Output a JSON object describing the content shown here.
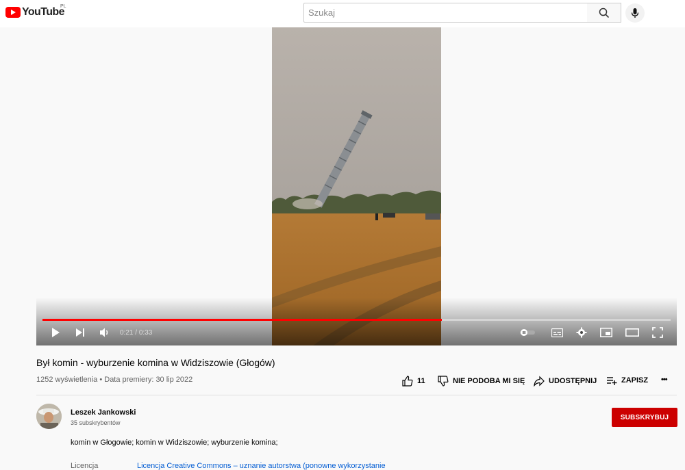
{
  "header": {
    "logo_text": "YouTube",
    "country_code": "PL",
    "search_placeholder": "Szukaj"
  },
  "player": {
    "time_current": "0:21",
    "time_separator": " / ",
    "time_total": "0:33",
    "progress_fraction": 0.636,
    "accent_color": "#ff0000"
  },
  "video": {
    "title": "Był komin - wyburzenie komina w Widziszowie (Głogów)",
    "views": "1252 wyświetlenia",
    "separator": " • ",
    "premiere": "Data premiery: 30 lip 2022"
  },
  "actions": {
    "like_count": "11",
    "dislike_label": "NIE PODOBA MI SIĘ",
    "share_label": "UDOSTĘPNIJ",
    "save_label": "ZAPISZ",
    "more_label": "•••"
  },
  "channel": {
    "name": "Leszek Jankowski",
    "subscribers": "35 subskrybentów",
    "subscribe_label": "SUBSKRYBUJ",
    "subscribe_color": "#cc0000"
  },
  "description": {
    "text": "komin w Głogowie; komin w Widziszowie; wyburzenie komina;",
    "license_label": "Licencja",
    "license_value": "Licencja Creative Commons – uznanie autorstwa (ponowne wykorzystanie"
  }
}
